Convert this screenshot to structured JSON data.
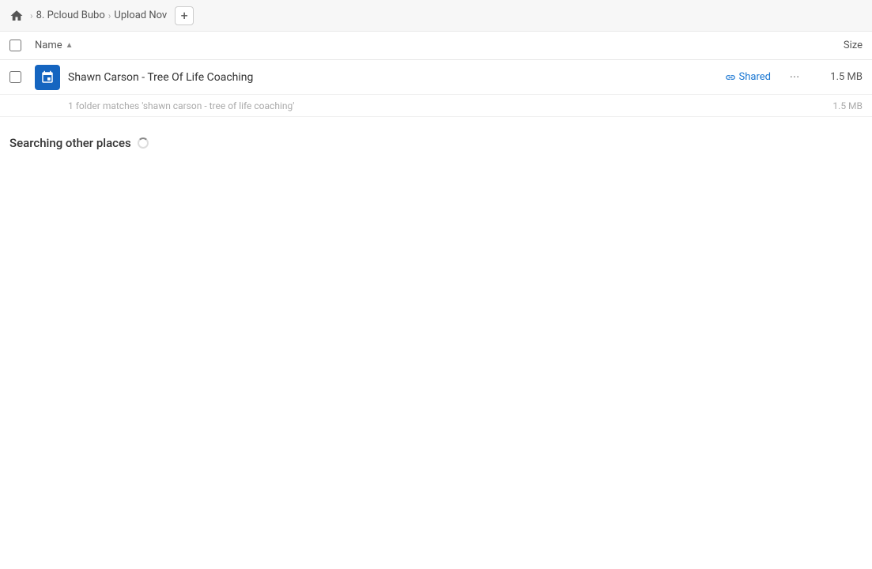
{
  "breadcrumb": {
    "home_label": "Home",
    "items": [
      {
        "label": "8. Pcloud Bubo"
      },
      {
        "label": "Upload Nov"
      }
    ],
    "add_button_label": "+"
  },
  "column_headers": {
    "name_label": "Name",
    "sort_direction": "▲",
    "size_label": "Size"
  },
  "file_row": {
    "name": "Shawn Carson - Tree Of Life Coaching",
    "shared_label": "Shared",
    "more_label": "···",
    "size": "1.5 MB"
  },
  "match_info": {
    "text": "1 folder matches 'shawn carson - tree of life coaching'",
    "size": "1.5 MB"
  },
  "searching_section": {
    "title": "Searching other places"
  }
}
